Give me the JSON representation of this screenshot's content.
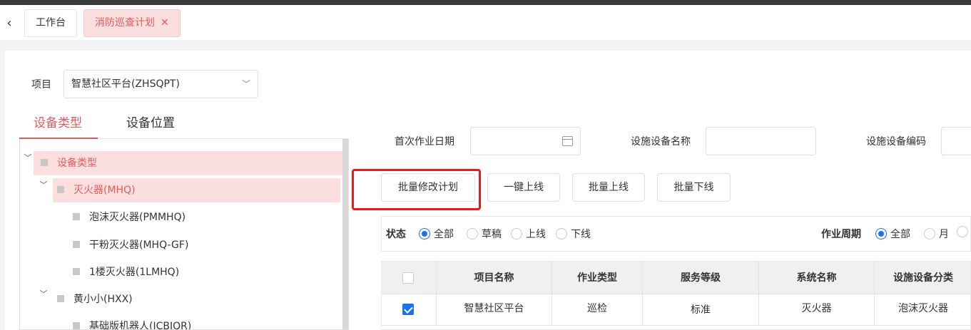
{
  "tabs": {
    "back_icon": "chevron-left-icon",
    "workbench": "工作台",
    "plan": "消防巡查计划",
    "close": "✕"
  },
  "project": {
    "label": "项目",
    "value": "智慧社区平台(ZHSQPT)"
  },
  "left_tabs": [
    "设备类型",
    "设备位置"
  ],
  "tree": [
    {
      "label": "设备类型",
      "expanded": true,
      "selected": true
    },
    {
      "label": "灭火器(MHQ)",
      "expanded": true,
      "selected": true
    },
    {
      "label": "泡沫灭火器(PMMHQ)"
    },
    {
      "label": "干粉灭火器(MHQ-GF)"
    },
    {
      "label": "1楼灭火器(1LMHQ)"
    },
    {
      "label": "黄小小(HXX)",
      "expanded": true
    },
    {
      "label": "基础版机器人(JCBJQR)"
    }
  ],
  "filters": {
    "first_date_label": "首次作业日期",
    "device_name_label": "设施设备名称",
    "device_code_label": "设施设备编码"
  },
  "buttons": {
    "batch_edit": "批量修改计划",
    "one_click_online": "一键上线",
    "batch_online": "批量上线",
    "batch_offline": "批量下线"
  },
  "status": {
    "label": "状态",
    "options": [
      "全部",
      "草稿",
      "上线",
      "下线"
    ],
    "selected": "全部"
  },
  "period": {
    "label": "作业周期",
    "options": [
      "全部",
      "月"
    ],
    "selected": "全部"
  },
  "table": {
    "columns": [
      "项目名称",
      "作业类型",
      "服务等级",
      "系统名称",
      "设施设备分类"
    ],
    "rows": [
      {
        "checked": true,
        "cells": [
          "智慧社区平台",
          "巡检",
          "标准",
          "灭火器",
          "泡沫灭火器"
        ]
      }
    ]
  },
  "colors": {
    "accent": "#e85a5a",
    "primary": "#1a73e8",
    "highlight": "#e81b1b"
  }
}
